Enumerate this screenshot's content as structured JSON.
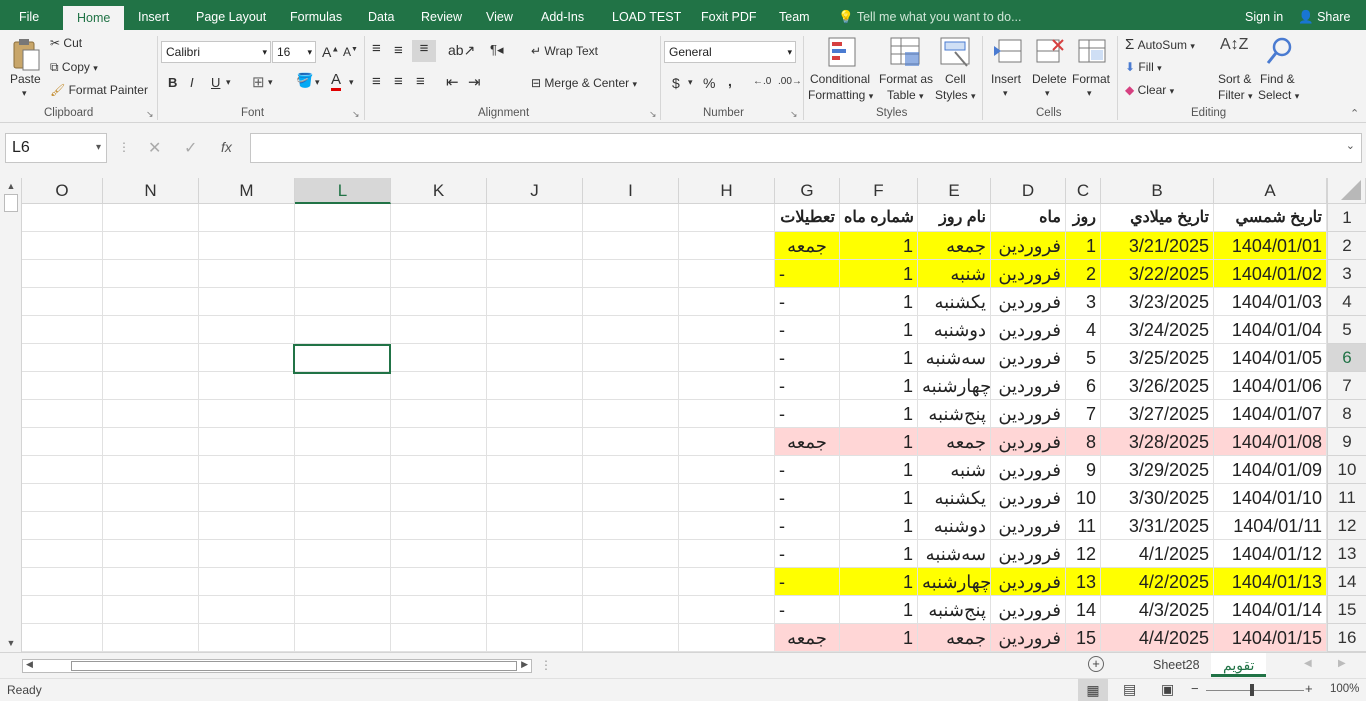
{
  "tabs": [
    {
      "label": "File"
    },
    {
      "label": "Home"
    },
    {
      "label": "Insert"
    },
    {
      "label": "Page Layout"
    },
    {
      "label": "Formulas"
    },
    {
      "label": "Data"
    },
    {
      "label": "Review"
    },
    {
      "label": "View"
    },
    {
      "label": "Add-Ins"
    },
    {
      "label": "LOAD TEST"
    },
    {
      "label": "Foxit PDF"
    },
    {
      "label": "Team"
    }
  ],
  "tell_me": "Tell me what you want to do...",
  "account": {
    "sign_in": "Sign in",
    "share": "Share"
  },
  "ribbon": {
    "clipboard": {
      "paste": "Paste",
      "cut": "Cut",
      "copy": "Copy",
      "format_painter": "Format Painter",
      "label": "Clipboard"
    },
    "font": {
      "name": "Calibri",
      "size": "16",
      "bold": "B",
      "italic": "I",
      "underline": "U",
      "label": "Font"
    },
    "alignment": {
      "wrap_text": "Wrap Text",
      "merge_center": "Merge & Center",
      "label": "Alignment"
    },
    "number": {
      "format": "General",
      "currency": "$",
      "percent": "%",
      "comma": ",",
      "label": "Number"
    },
    "styles": {
      "conditional": "Conditional",
      "formatting": "Formatting",
      "format_as": "Format as",
      "table": "Table",
      "cell": "Cell",
      "cell_styles": "Styles",
      "label": "Styles"
    },
    "cells": {
      "insert": "Insert",
      "delete": "Delete",
      "format": "Format",
      "label": "Cells"
    },
    "editing": {
      "autosum": "AutoSum",
      "fill": "Fill",
      "clear": "Clear",
      "sort": "Sort &",
      "filter": "Filter",
      "find": "Find &",
      "select": "Select",
      "label": "Editing"
    }
  },
  "formula_bar": {
    "name_box": "L6",
    "fx": "fx",
    "value": ""
  },
  "columns": [
    "O",
    "N",
    "M",
    "L",
    "K",
    "J",
    "I",
    "H",
    "G",
    "F",
    "E",
    "D",
    "C",
    "B",
    "A"
  ],
  "selected_column": "L",
  "selected_row": 6,
  "header_row": {
    "A": "تاريخ شمسي",
    "B": "تاريخ ميلادي",
    "C": "روز",
    "D": "ماه",
    "E": "نام روز",
    "F": "شماره ماه",
    "G": "تعطيلات"
  },
  "rows": [
    {
      "n": "2",
      "A": "1404/01/01",
      "B": "3/21/2025",
      "C": "1",
      "D": "فروردين",
      "E": "جمعه",
      "F": "1",
      "G": "جمعه",
      "fill": "#ffff00"
    },
    {
      "n": "3",
      "A": "1404/01/02",
      "B": "3/22/2025",
      "C": "2",
      "D": "فروردين",
      "E": "شنبه",
      "F": "1",
      "G": "-",
      "fill": "#ffff00"
    },
    {
      "n": "4",
      "A": "1404/01/03",
      "B": "3/23/2025",
      "C": "3",
      "D": "فروردين",
      "E": "يکشنبه",
      "F": "1",
      "G": "-",
      "fill": ""
    },
    {
      "n": "5",
      "A": "1404/01/04",
      "B": "3/24/2025",
      "C": "4",
      "D": "فروردين",
      "E": "دوشنبه",
      "F": "1",
      "G": "-",
      "fill": ""
    },
    {
      "n": "6",
      "A": "1404/01/05",
      "B": "3/25/2025",
      "C": "5",
      "D": "فروردين",
      "E": "سه‌شنبه",
      "F": "1",
      "G": "-",
      "fill": ""
    },
    {
      "n": "7",
      "A": "1404/01/06",
      "B": "3/26/2025",
      "C": "6",
      "D": "فروردين",
      "E": "چهارشنبه",
      "F": "1",
      "G": "-",
      "fill": ""
    },
    {
      "n": "8",
      "A": "1404/01/07",
      "B": "3/27/2025",
      "C": "7",
      "D": "فروردين",
      "E": "پنج‌شنبه",
      "F": "1",
      "G": "-",
      "fill": ""
    },
    {
      "n": "9",
      "A": "1404/01/08",
      "B": "3/28/2025",
      "C": "8",
      "D": "فروردين",
      "E": "جمعه",
      "F": "1",
      "G": "جمعه",
      "fill": "#ffd6d6"
    },
    {
      "n": "10",
      "A": "1404/01/09",
      "B": "3/29/2025",
      "C": "9",
      "D": "فروردين",
      "E": "شنبه",
      "F": "1",
      "G": "-",
      "fill": ""
    },
    {
      "n": "11",
      "A": "1404/01/10",
      "B": "3/30/2025",
      "C": "10",
      "D": "فروردين",
      "E": "يکشنبه",
      "F": "1",
      "G": "-",
      "fill": ""
    },
    {
      "n": "12",
      "A": "1404/01/11",
      "B": "3/31/2025",
      "C": "11",
      "D": "فروردين",
      "E": "دوشنبه",
      "F": "1",
      "G": "-",
      "fill": ""
    },
    {
      "n": "13",
      "A": "1404/01/12",
      "B": "4/1/2025",
      "C": "12",
      "D": "فروردين",
      "E": "سه‌شنبه",
      "F": "1",
      "G": "-",
      "fill": ""
    },
    {
      "n": "14",
      "A": "1404/01/13",
      "B": "4/2/2025",
      "C": "13",
      "D": "فروردين",
      "E": "چهارشنبه",
      "F": "1",
      "G": "-",
      "fill": "#ffff00"
    },
    {
      "n": "15",
      "A": "1404/01/14",
      "B": "4/3/2025",
      "C": "14",
      "D": "فروردين",
      "E": "پنج‌شنبه",
      "F": "1",
      "G": "-",
      "fill": ""
    },
    {
      "n": "16",
      "A": "1404/01/15",
      "B": "4/4/2025",
      "C": "15",
      "D": "فروردين",
      "E": "جمعه",
      "F": "1",
      "G": "جمعه",
      "fill": "#ffd6d6"
    }
  ],
  "sheet_tabs": [
    {
      "label": "Sheet28",
      "active": false
    },
    {
      "label": "تقويم",
      "active": true
    }
  ],
  "status": {
    "ready": "Ready",
    "zoom": "100%"
  },
  "colors": {
    "accent": "#217346",
    "highlight_yellow": "#ffff00",
    "highlight_pink": "#ffd6d6"
  }
}
